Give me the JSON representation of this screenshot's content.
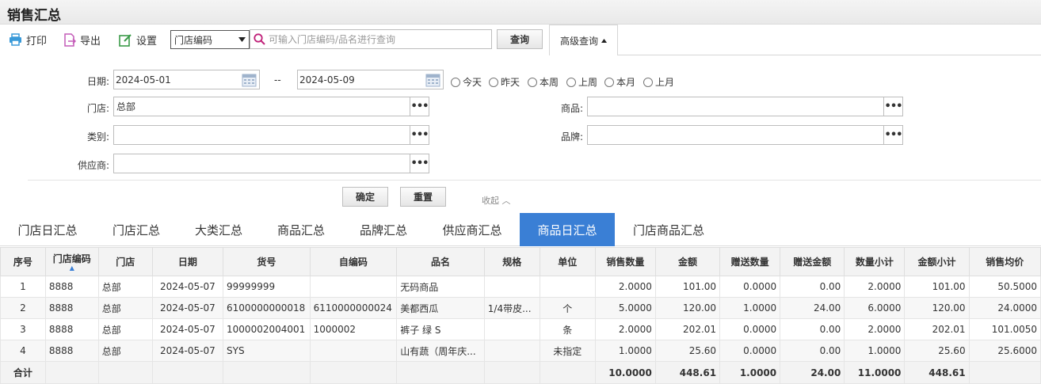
{
  "page": {
    "title": "销售汇总"
  },
  "toolbar": {
    "print_label": "打印",
    "export_label": "导出",
    "settings_label": "设置",
    "search_field_selected": "门店编码",
    "search_placeholder": "可输入门店编码/品名进行查询",
    "query_label": "查询",
    "advanced_label": "高级查询"
  },
  "filters": {
    "date_label": "日期:",
    "date_from": "2024-05-01",
    "date_sep": "--",
    "date_to": "2024-05-09",
    "quick_dates": [
      "今天",
      "昨天",
      "本周",
      "上周",
      "本月",
      "上月"
    ],
    "store_label": "门店:",
    "store_value": "总部",
    "category_label": "类别:",
    "category_value": "",
    "supplier_label": "供应商:",
    "supplier_value": "",
    "product_label": "商品:",
    "product_value": "",
    "brand_label": "品牌:",
    "brand_value": "",
    "more_label": "•••",
    "confirm_label": "确定",
    "reset_label": "重置",
    "collapse_label": "收起 ︿"
  },
  "tabs": [
    {
      "label": "门店日汇总",
      "active": false
    },
    {
      "label": "门店汇总",
      "active": false
    },
    {
      "label": "大类汇总",
      "active": false
    },
    {
      "label": "商品汇总",
      "active": false
    },
    {
      "label": "品牌汇总",
      "active": false
    },
    {
      "label": "供应商汇总",
      "active": false
    },
    {
      "label": "商品日汇总",
      "active": true
    },
    {
      "label": "门店商品汇总",
      "active": false
    }
  ],
  "table": {
    "headers": [
      "序号",
      "门店编码",
      "门店",
      "日期",
      "货号",
      "自编码",
      "品名",
      "规格",
      "单位",
      "销售数量",
      "金额",
      "赠送数量",
      "赠送金额",
      "数量小计",
      "金额小计",
      "销售均价"
    ],
    "rows": [
      [
        "1",
        "8888",
        "总部",
        "2024-05-07",
        "99999999",
        "",
        "无码商品",
        "",
        "",
        "2.0000",
        "101.00",
        "0.0000",
        "0.00",
        "2.0000",
        "101.00",
        "50.5000"
      ],
      [
        "2",
        "8888",
        "总部",
        "2024-05-07",
        "6100000000018",
        "6110000000024",
        "美都西瓜",
        "1/4带皮...",
        "个",
        "5.0000",
        "120.00",
        "1.0000",
        "24.00",
        "6.0000",
        "120.00",
        "24.0000"
      ],
      [
        "3",
        "8888",
        "总部",
        "2024-05-07",
        "1000002004001",
        "1000002",
        "裤子 绿 S",
        "",
        "条",
        "2.0000",
        "202.01",
        "0.0000",
        "0.00",
        "2.0000",
        "202.01",
        "101.0050"
      ],
      [
        "4",
        "8888",
        "总部",
        "2024-05-07",
        "SYS",
        "",
        "山有蔬（周年庆...",
        "",
        "未指定",
        "1.0000",
        "25.60",
        "0.0000",
        "0.00",
        "1.0000",
        "25.60",
        "25.6000"
      ]
    ],
    "total": [
      "合计",
      "",
      "",
      "",
      "",
      "",
      "",
      "",
      "",
      "10.0000",
      "448.61",
      "1.0000",
      "24.00",
      "11.0000",
      "448.61",
      ""
    ]
  },
  "colors": {
    "accent": "#3a7fd5",
    "print_icon": "#3a9ad9",
    "export_icon": "#c45bb8",
    "settings_icon": "#3a9a48"
  }
}
